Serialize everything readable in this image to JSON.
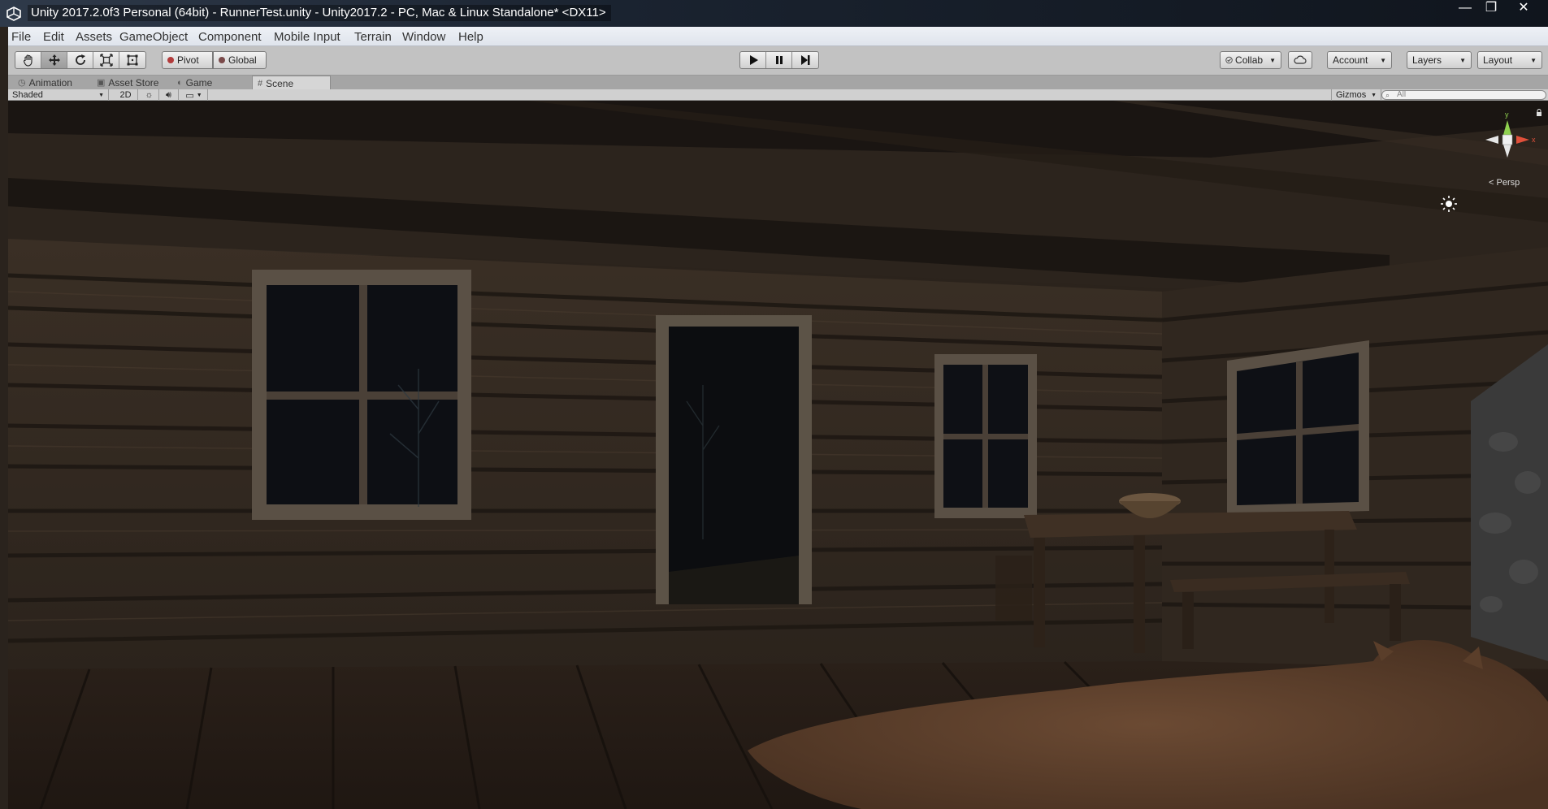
{
  "window": {
    "title": "Unity 2017.2.0f3 Personal (64bit) - RunnerTest.unity - Unity2017.2 - PC, Mac & Linux Standalone* <DX11>",
    "controls": {
      "minimize": "—",
      "maximize": "❐",
      "close": "✕"
    }
  },
  "menu": {
    "items": [
      "File",
      "Edit",
      "Assets",
      "GameObject",
      "Component",
      "Mobile Input",
      "Terrain",
      "Window",
      "Help"
    ]
  },
  "toolbar": {
    "transform_tools": [
      "hand-icon",
      "move-icon",
      "rotate-icon",
      "scale-icon",
      "rect-icon"
    ],
    "active_tool": "move",
    "pivot_label": "Pivot",
    "global_label": "Global",
    "play_controls": [
      "play-icon",
      "pause-icon",
      "step-icon"
    ],
    "collab_label": "Collab",
    "account_label": "Account",
    "layers_label": "Layers",
    "layout_label": "Layout"
  },
  "tabs": [
    {
      "label": "Animation",
      "icon": "clock-icon",
      "active": false
    },
    {
      "label": "Asset Store",
      "icon": "store-icon",
      "active": false
    },
    {
      "label": "Game",
      "icon": "game-icon",
      "active": false
    },
    {
      "label": "Scene",
      "icon": "grid-icon",
      "active": true
    }
  ],
  "scene_toolbar": {
    "shading_mode": "Shaded",
    "mode_2d": "2D",
    "gizmos_label": "Gizmos",
    "search_placeholder": "All"
  },
  "scene_view": {
    "projection_label": "Persp",
    "axis_labels": {
      "y": "y",
      "x": "x"
    },
    "colors": {
      "y_axis": "#8fd14f",
      "x_axis": "#e0503a",
      "z_axis": "#4a90e2"
    }
  },
  "colors": {
    "editor_bg": "#c2c2c2",
    "menubar_bg": "#e7ebf1",
    "titlebar_bg": "#1a2330"
  }
}
